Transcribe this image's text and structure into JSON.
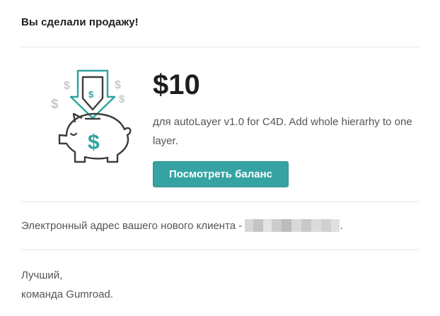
{
  "email": {
    "heading": "Вы сделали продажу!",
    "amount": "$10",
    "description": "для autoLayer v1.0 for C4D. Add whole hierarhy to one layer.",
    "balance_button_label": "Посмотреть баланс",
    "email_label": "Электронный адрес вашего нового клиента -",
    "email_suffix": ".",
    "signoff_line1": "Лучший,",
    "signoff_line2": "команда Gumroad."
  },
  "illustration": {
    "icon": "piggy-bank-sale-icon",
    "accent_color": "#2ea3a0",
    "stroke_color": "#3d3d3d",
    "dollar_gray": "#c8c8c8"
  },
  "colors": {
    "button": "#36a3a3",
    "divider": "#e6e6e6"
  }
}
